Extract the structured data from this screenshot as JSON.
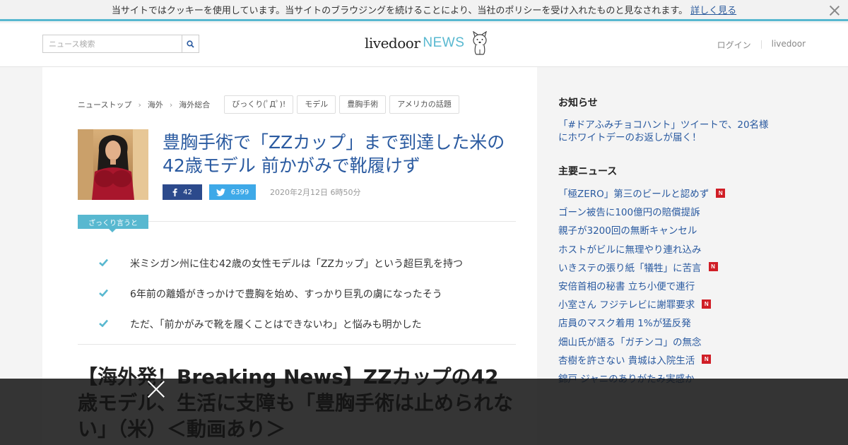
{
  "cookie_bar": {
    "message": "当サイトではクッキーを使用しています。当サイトのブラウジングを続けることにより、当社のポリシーを受け入れたものと見なされます。",
    "link_label": "詳しく見る"
  },
  "header": {
    "search_placeholder": "ニュース検索",
    "logo_livedoor": "livedoor",
    "logo_news": "NEWS",
    "login_label": "ログイン",
    "livedoor_label": "livedoor"
  },
  "breadcrumb": [
    "ニューストップ",
    "海外",
    "海外総合"
  ],
  "tags": [
    "びっくり(ﾟДﾟ)!",
    "モデル",
    "豊胸手術",
    "アメリカの話題"
  ],
  "article": {
    "title": "豊胸手術で「ZZカップ」まで到達した米の42歳モデル 前かがみで靴履けず",
    "facebook_count": "42",
    "twitter_count": "6399",
    "date": "2020年2月12日 6時50分",
    "summary_label": "ざっくり言うと",
    "summary": [
      "米ミシガン州に住む42歳の女性モデルは「ZZカップ」という超巨乳を持つ",
      "6年前の離婚がきっかけで豊胸を始め、すっかり巨乳の虜になったそう",
      "ただ、「前かがみで靴を履くことはできないわ」と悩みも明かした"
    ],
    "headline": "【海外発！Breaking News】ZZカップの42歳モデル、生活に支障も「豊胸手術は止められない」（米）＜動画あり＞"
  },
  "sidebar": {
    "notice_title": "お知らせ",
    "notice_link": "「#ドアふみチョコハント」ツイートで、20名様にホワイトデーのお返しが届く！",
    "major_title": "主要ニュース",
    "new_badge": "N",
    "news": [
      {
        "label": "「極ZERO」第三のビールと認めず",
        "is_new": true
      },
      {
        "label": "ゴーン被告に100億円の賠償提訴",
        "is_new": false
      },
      {
        "label": "親子が3200回の無断キャンセル",
        "is_new": false
      },
      {
        "label": "ホストがビルに無理やり連れ込み",
        "is_new": false
      },
      {
        "label": "いきステの張り紙「犠牲」に苦言",
        "is_new": true
      },
      {
        "label": "安倍首相の秘書 立ち小便で連行",
        "is_new": false
      },
      {
        "label": "小室さん フジテレビに謝罪要求",
        "is_new": true
      },
      {
        "label": "店員のマスク着用 1%が猛反発",
        "is_new": false
      },
      {
        "label": "畑山氏が語る「ガチンコ」の無念",
        "is_new": false
      },
      {
        "label": "杏樹を許さない 貴城は入院生活",
        "is_new": true
      },
      {
        "label": "錦戸 ジャニのありがたみ実感か",
        "is_new": false
      }
    ]
  },
  "colors": {
    "accent": "#58b8d0",
    "link": "#2a5aa0",
    "facebook": "#2c4a8c",
    "twitter": "#3ea9e8",
    "new_badge": "#d01e26"
  }
}
